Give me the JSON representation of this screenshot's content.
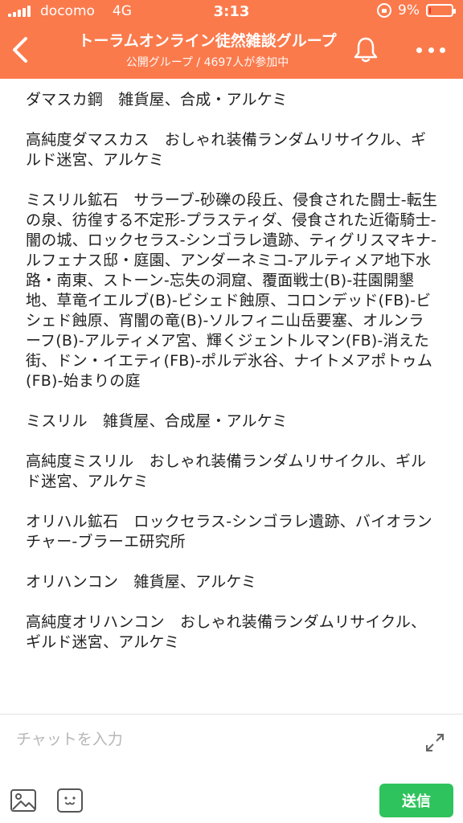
{
  "status_bar": {
    "carrier": "docomo",
    "network": "4G",
    "time": "3:13",
    "battery_text": "9%",
    "battery_level": 0.09,
    "battery_color": "#e0362a"
  },
  "header": {
    "background": "#fb7a4c",
    "title": "トーラムオンライン徒然雑談グループ",
    "subtitle": "公開グループ / 4697人が参加中",
    "icons": [
      "back-icon",
      "bell-icon",
      "more-icon"
    ]
  },
  "message": {
    "paragraphs": [
      "ダマスカ鋼　雑貨屋、合成・アルケミ",
      "高純度ダマスカス　おしゃれ装備ランダムリサイクル、ギルド迷宮、アルケミ",
      "ミスリル鉱石　サラーブ-砂礫の段丘、侵食された闘士-転生の泉、彷徨する不定形-プラスティダ、侵食された近衛騎士-闇の城、ロックセラス-シンゴラレ遺跡、ティグリスマキナ-ルフェナス邸・庭園、アンダーネミコ-アルティメア地下水路・南東、ストーン-忘失の洞窟、覆面戦士(B)-荘園開墾地、草竜イエルブ(B)-ビシェド蝕原、コロンデッド(FB)-ビシェド蝕原、宵闇の竜(B)-ソルフィニ山岳要塞、オルンラーフ(B)-アルティメア宮、輝くジェントルマン(FB)-消えた街、ドン・イエティ(FB)-ポルデ氷谷、ナイトメアポトゥム(FB)-始まりの庭",
      "ミスリル　雑貨屋、合成屋・アルケミ",
      "高純度ミスリル　おしゃれ装備ランダムリサイクル、ギルド迷宮、アルケミ",
      "オリハル鉱石　ロックセラス-シンゴラレ遺跡、バイオランチャー-ブラーエ研究所",
      "オリハンコン　雑貨屋、アルケミ",
      "高純度オリハンコン　おしゃれ装備ランダムリサイクル、ギルド迷宮、アルケミ"
    ]
  },
  "composer": {
    "placeholder": "チャットを入力",
    "send_label": "送信",
    "send_color": "#2ec35c",
    "icons": [
      "expand-icon",
      "image-icon",
      "emoji-icon"
    ]
  }
}
